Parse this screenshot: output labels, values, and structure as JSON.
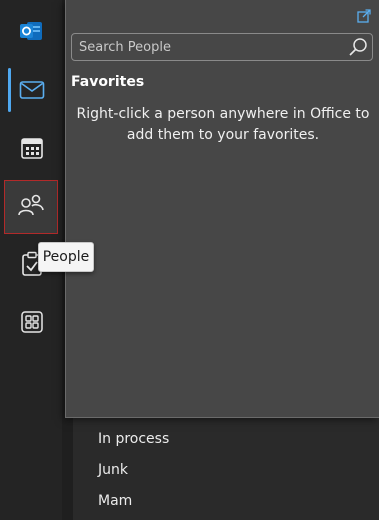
{
  "rail": {
    "items": [
      {
        "name": "mail",
        "icon": "mail-icon"
      },
      {
        "name": "calendar",
        "icon": "calendar-icon"
      },
      {
        "name": "people",
        "icon": "people-icon"
      },
      {
        "name": "tasks",
        "icon": "tasks-icon"
      },
      {
        "name": "more-apps",
        "icon": "apps-grid-icon"
      }
    ],
    "app_logo": "outlook-logo-icon",
    "accent_color": "#4fa8f0"
  },
  "tooltip": {
    "text": "People"
  },
  "people_peek": {
    "search_placeholder": "Search People",
    "favorites_heading": "Favorites",
    "favorites_hint": "Right-click a person anywhere in Office to add them to your favorites.",
    "popout_icon": "pop-out-icon"
  },
  "folders": {
    "items": [
      "In process",
      "Junk",
      "Mam"
    ]
  }
}
